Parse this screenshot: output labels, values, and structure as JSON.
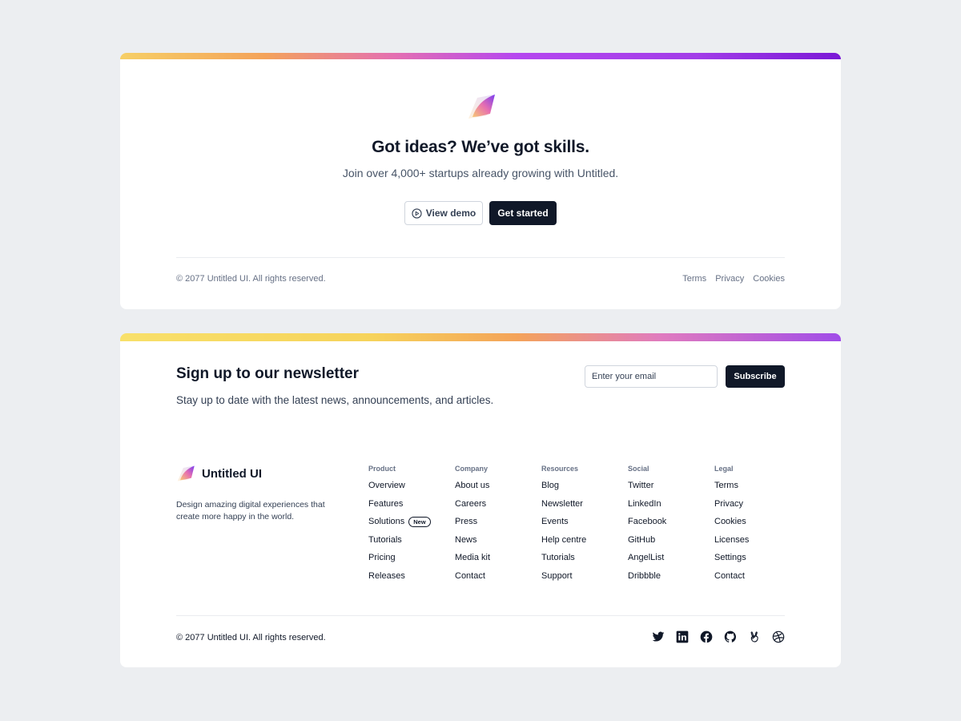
{
  "cta": {
    "title": "Got ideas? We’ve got skills.",
    "subtitle": "Join over 4,000+ startups already growing with Untitled.",
    "view_demo": "View demo",
    "get_started": "Get started",
    "copyright": "© 2077 Untitled UI. All rights reserved.",
    "legal": [
      "Terms",
      "Privacy",
      "Cookies"
    ]
  },
  "newsletter": {
    "title": "Sign up to our newsletter",
    "subtitle": "Stay up to date with the latest news, announcements, and articles.",
    "email_placeholder": "Enter your email",
    "subscribe": "Subscribe"
  },
  "brand": {
    "name": "Untitled UI",
    "description": "Design amazing digital experiences that create more happy in the world."
  },
  "columns": [
    {
      "heading": "Product",
      "items": [
        "Overview",
        "Features",
        "Solutions",
        "Tutorials",
        "Pricing",
        "Releases"
      ],
      "badge": "New"
    },
    {
      "heading": "Company",
      "items": [
        "About us",
        "Careers",
        "Press",
        "News",
        "Media kit",
        "Contact"
      ]
    },
    {
      "heading": "Resources",
      "items": [
        "Blog",
        "Newsletter",
        "Events",
        "Help centre",
        "Tutorials",
        "Support"
      ]
    },
    {
      "heading": "Social",
      "items": [
        "Twitter",
        "LinkedIn",
        "Facebook",
        "GitHub",
        "AngelList",
        "Dribbble"
      ]
    },
    {
      "heading": "Legal",
      "items": [
        "Terms",
        "Privacy",
        "Cookies",
        "Licenses",
        "Settings",
        "Contact"
      ]
    }
  ],
  "footer": {
    "copyright": "© 2077 Untitled UI. All rights reserved.",
    "social_icons": [
      "twitter-icon",
      "linkedin-icon",
      "facebook-icon",
      "github-icon",
      "angellist-icon",
      "dribbble-icon"
    ]
  },
  "colors": {
    "page_bg": "#eceef1",
    "primary_dark": "#101828",
    "accent_purple": "#a23de8",
    "accent_yellow": "#f6cf66"
  }
}
